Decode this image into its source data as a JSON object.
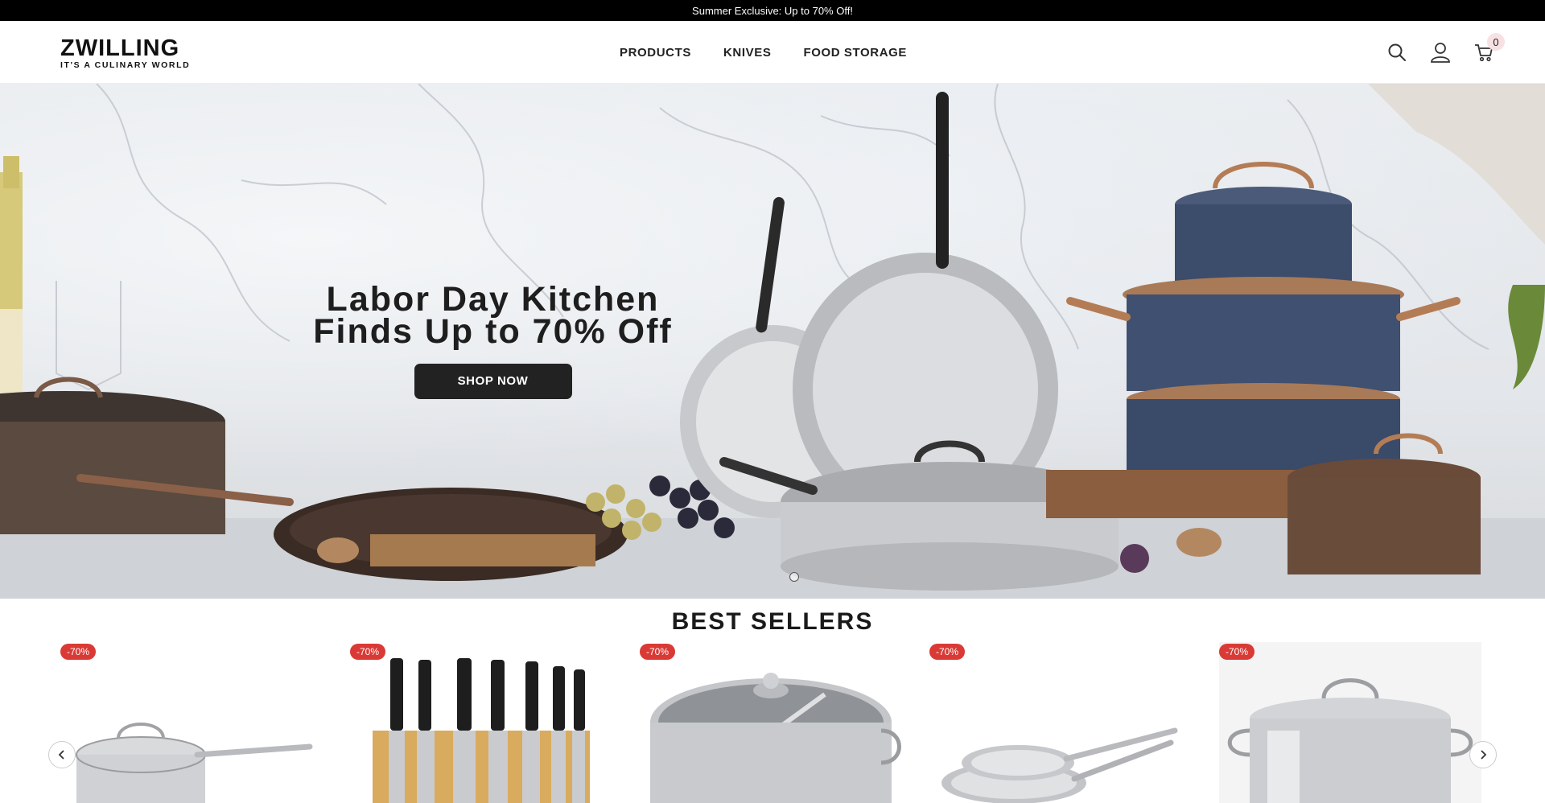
{
  "announcement": "Summer Exclusive: Up to 70% Off!",
  "brand": {
    "name": "ZWILLING",
    "tagline": "IT'S A CULINARY WORLD"
  },
  "nav": {
    "items": [
      "PRODUCTS",
      "KNIVES",
      "FOOD STORAGE"
    ]
  },
  "header_icons": {
    "search": "search-icon",
    "account": "user-icon",
    "cart": "cart-icon",
    "cart_count": "0"
  },
  "hero": {
    "title_line1": "Labor Day Kitchen",
    "title_line2": "Finds Up to 70% Off",
    "cta": "SHOP NOW"
  },
  "section": {
    "title": "BEST SELLERS"
  },
  "products": [
    {
      "badge": "-70%",
      "kind": "saucepan"
    },
    {
      "badge": "-70%",
      "kind": "knife-block"
    },
    {
      "badge": "-70%",
      "kind": "pasta-pot"
    },
    {
      "badge": "-70%",
      "kind": "fry-pans"
    },
    {
      "badge": "-70%",
      "kind": "stock-pot"
    }
  ],
  "carousel": {
    "prev": "chevron-left-icon",
    "next": "chevron-right-icon"
  }
}
